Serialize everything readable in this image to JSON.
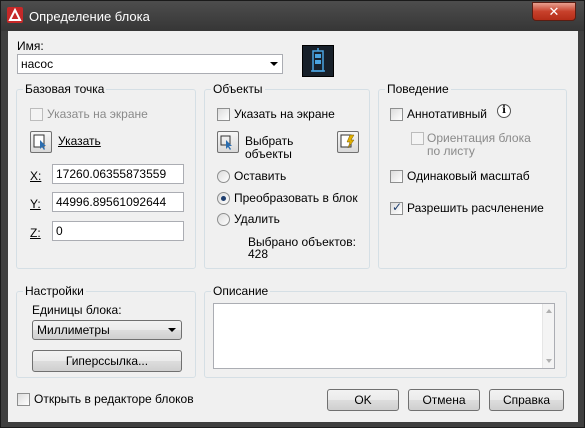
{
  "window": {
    "title": "Определение блока",
    "close_glyph": "✕"
  },
  "name": {
    "label": "Имя:",
    "value": "насос"
  },
  "base_point": {
    "legend": "Базовая точка",
    "specify_on_screen": "Указать на экране",
    "pick_label": "Указать",
    "x_label": "X:",
    "x_value": "17260.06355873559",
    "y_label": "Y:",
    "y_value": "44996.89561092644",
    "z_label": "Z:",
    "z_value": "0"
  },
  "objects": {
    "legend": "Объекты",
    "specify_on_screen": "Указать на экране",
    "select_objects_line1": "Выбрать",
    "select_objects_line2": "объекты",
    "retain": "Оставить",
    "convert": "Преобразовать в блок",
    "delete": "Удалить",
    "selected_count_label": "Выбрано объектов:",
    "selected_count": "428"
  },
  "behavior": {
    "legend": "Поведение",
    "annotative": "Аннотативный",
    "info_glyph": "i",
    "orient_line1": "Ориентация блока",
    "orient_line2": "по листу",
    "uniform_scale": "Одинаковый масштаб",
    "allow_explode": "Разрешить расчленение"
  },
  "settings": {
    "legend": "Настройки",
    "units_label": "Единицы блока:",
    "units_value": "Миллиметры",
    "hyperlink_button": "Гиперссылка..."
  },
  "description": {
    "legend": "Описание",
    "value": ""
  },
  "footer": {
    "open_in_editor": "Открыть в редакторе блоков",
    "ok": "OK",
    "cancel": "Отмена",
    "help": "Справка"
  },
  "colors": {
    "titlebar": "#3f3f3f",
    "dialog_bg": "#f0f0f0",
    "close_button": "#c7402b",
    "preview_bg": "#17202a",
    "preview_fg": "#4aa3df"
  }
}
